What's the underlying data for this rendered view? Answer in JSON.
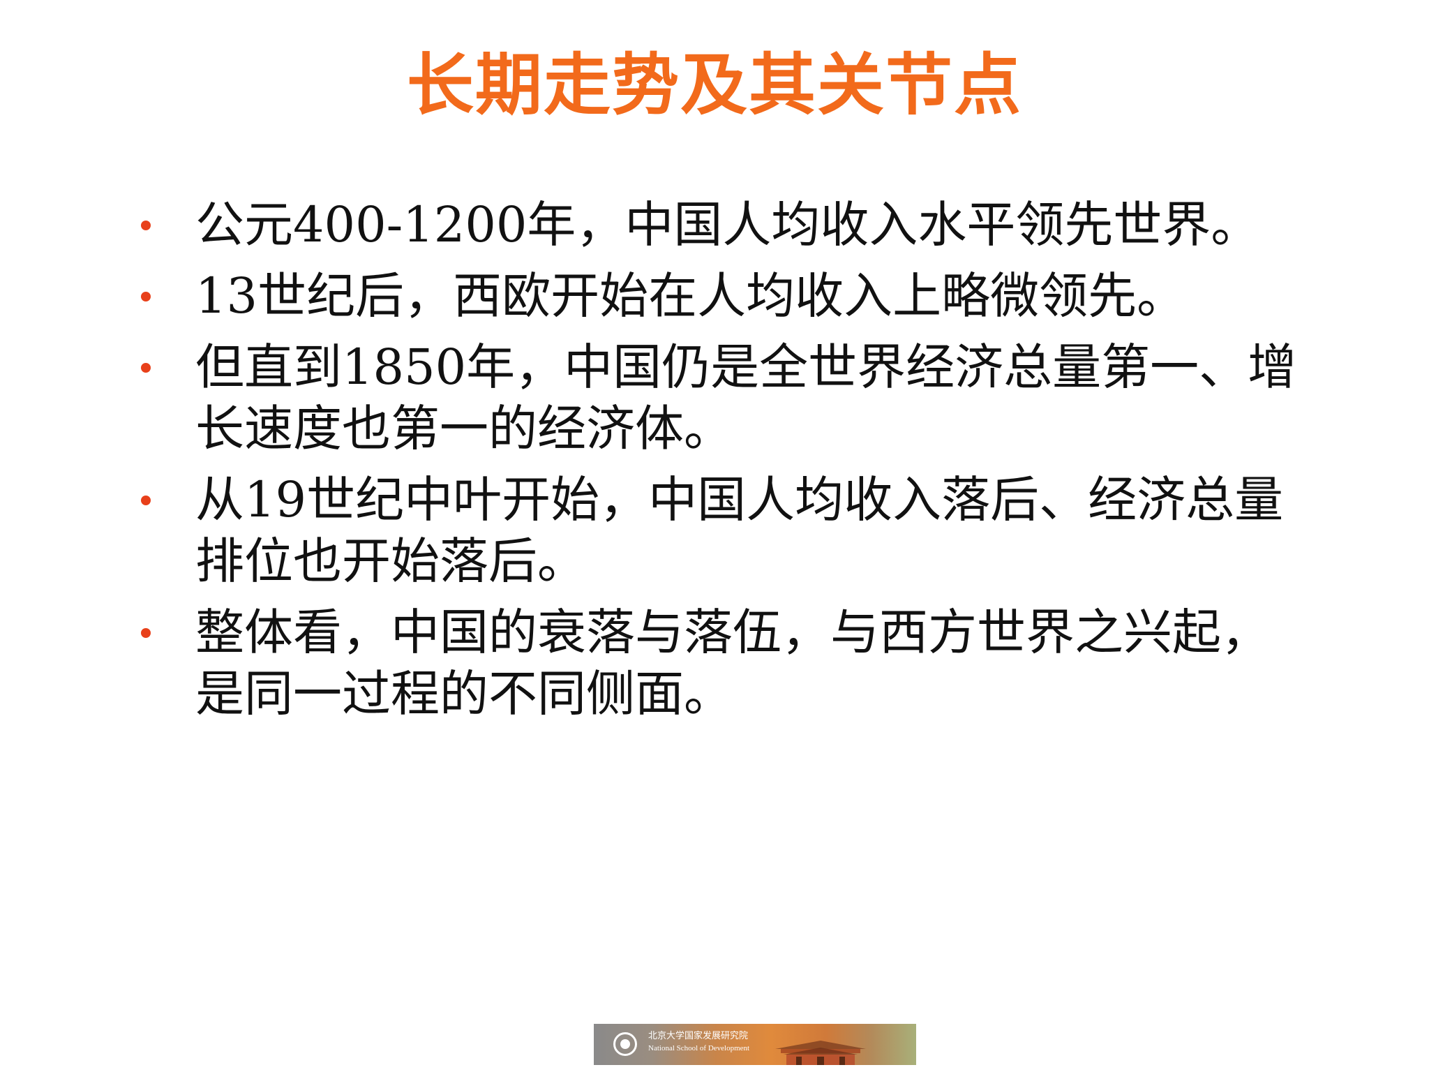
{
  "slide": {
    "title": "长期走势及其关节点",
    "title_color": "#f26a1b",
    "bullet_color": "#e8401a",
    "bullets": [
      {
        "text": "公元400-1200年，中国人均收入水平领先世界。"
      },
      {
        "text": "13世纪后，西欧开始在人均收入上略微领先。"
      },
      {
        "text": "但直到1850年，中国仍是全世界经济总量第一、增长速度也第一的经济体。"
      },
      {
        "text": "从19世纪中叶开始，中国人均收入落后、经济总量排位也开始落后。"
      },
      {
        "text": "整体看，中国的衰落与落伍，与西方世界之兴起，是同一过程的不同侧面。"
      }
    ]
  },
  "footer": {
    "logo_cn": "北京大学国家发展研究院",
    "logo_en": "National School of Development"
  }
}
